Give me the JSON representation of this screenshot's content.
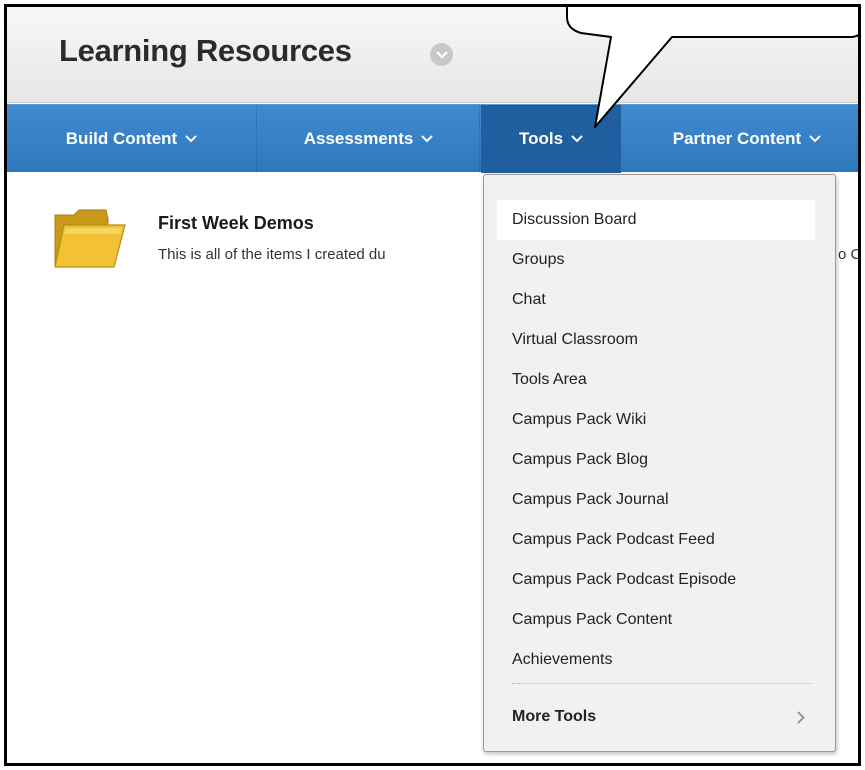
{
  "header": {
    "title": "Learning Resources"
  },
  "nav": {
    "items": [
      {
        "label": "Build Content"
      },
      {
        "label": "Assessments"
      },
      {
        "label": "Tools"
      },
      {
        "label": "Partner Content"
      }
    ]
  },
  "content": {
    "item_title": "First Week Demos",
    "item_description": "This is all of the items I created du",
    "item_description_tail": "o C",
    "icon": "folder-icon"
  },
  "tools_menu": {
    "items": [
      {
        "label": "Discussion Board"
      },
      {
        "label": "Groups"
      },
      {
        "label": "Chat"
      },
      {
        "label": "Virtual Classroom"
      },
      {
        "label": "Tools Area"
      },
      {
        "label": "Campus Pack Wiki"
      },
      {
        "label": "Campus Pack Blog"
      },
      {
        "label": "Campus Pack Journal"
      },
      {
        "label": "Campus Pack Podcast Feed"
      },
      {
        "label": "Campus Pack Podcast Episode"
      },
      {
        "label": "Campus Pack Content"
      },
      {
        "label": "Achievements"
      }
    ],
    "more_label": "More Tools"
  },
  "colors": {
    "nav_bg": "#3480c6",
    "nav_active": "#1f5f9f",
    "menu_bg": "#f1f1f1"
  }
}
